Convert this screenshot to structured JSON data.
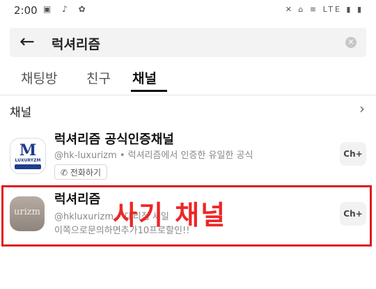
{
  "status_bar": {
    "time": "2:00",
    "left_icons": "▣ ♪ ✿",
    "right_icons": "✕ ⌂ ≋ LTE ▮ ▮"
  },
  "search": {
    "query": "럭셔리즘",
    "back_icon": "arrow-left-icon",
    "clear_icon": "clear-icon"
  },
  "tabs": [
    {
      "label": "채팅방",
      "active": false
    },
    {
      "label": "친구",
      "active": false
    },
    {
      "label": "채널",
      "active": true
    }
  ],
  "section": {
    "title": "채널"
  },
  "channels": [
    {
      "name": "럭셔리즘 공식인증채널",
      "description": "@hk-luxurizm • 럭셔리즘에서 인증한 유일한 공식",
      "chip": "전화하기",
      "logo_text": "LUXURYZM",
      "add_label": "Ch+"
    },
    {
      "name": "럭셔리즘",
      "description": "@hkluxurizm • 대리점 세일",
      "description2": "이쪽으로문의하면추가10프로할인!!",
      "logo_text": "urizm",
      "add_label": "Ch+"
    }
  ],
  "annotation": {
    "text": "사기 채널",
    "color": "#e0191d"
  },
  "colors": {
    "accent_red": "#e0191d",
    "logo_blue": "#1f3d8c"
  }
}
